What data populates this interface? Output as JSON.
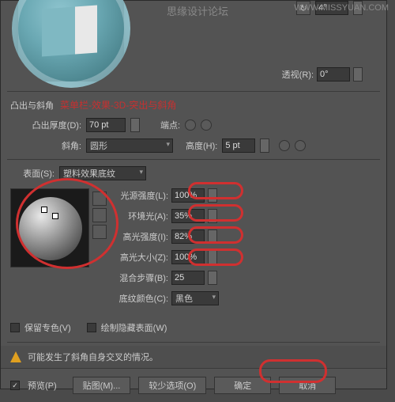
{
  "watermark": {
    "forum": "思缘设计论坛",
    "url": "WWW.MISSYUAN.COM"
  },
  "rotation": {
    "z_value": "4°"
  },
  "perspective": {
    "label": "透视(R):",
    "value": "0°"
  },
  "extrude": {
    "header": "凸出与斜角",
    "note": "菜单栏-效果-3D-突出与斜角",
    "depth_label": "凸出厚度(D):",
    "depth_value": "70 pt",
    "cap_label": "端点:",
    "bevel_label": "斜角:",
    "bevel_value": "圆形",
    "height_label": "高度(H):",
    "height_value": "5 pt"
  },
  "surface": {
    "label": "表面(S):",
    "value": "塑料效果底纹",
    "intensity_label": "光源强度(L):",
    "intensity_value": "100%",
    "ambient_label": "环境光(A):",
    "ambient_value": "35%",
    "highlight_int_label": "高光强度(I):",
    "highlight_int_value": "82%",
    "highlight_size_label": "高光大小(Z):",
    "highlight_size_value": "100%",
    "blend_label": "混合步骤(B):",
    "blend_value": "25",
    "shade_color_label": "底纹颜色(C):",
    "shade_color_value": "黑色"
  },
  "options": {
    "preserve_spot": "保留专色(V)",
    "draw_hidden": "绘制隐藏表面(W)"
  },
  "warning": "可能发生了斜角自身交叉的情况。",
  "buttons": {
    "preview": "预览(P)",
    "map_art": "贴图(M)...",
    "fewer": "较少选项(O)",
    "ok": "确定",
    "cancel": "取消"
  }
}
